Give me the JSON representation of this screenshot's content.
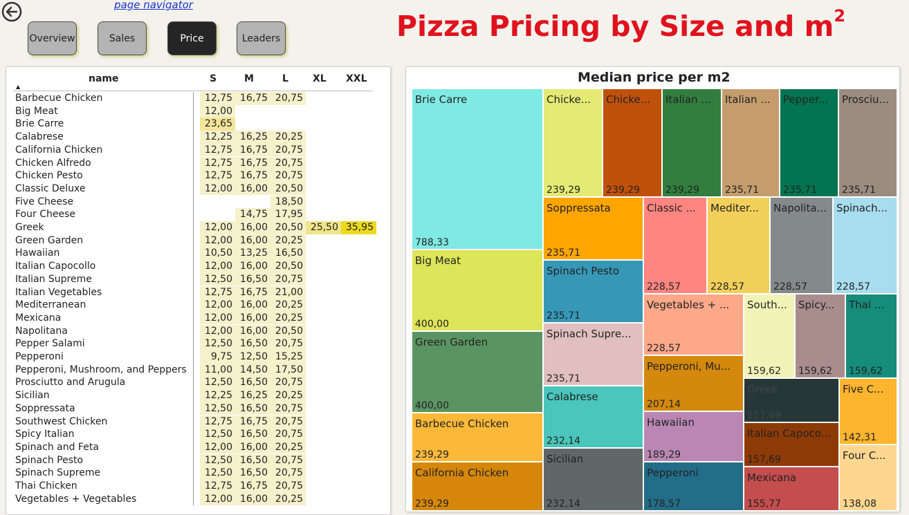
{
  "nav": {
    "link_text": "page navigator",
    "buttons": [
      "Overview",
      "Sales",
      "Price",
      "Leaders"
    ],
    "active": "Price"
  },
  "title": "Pizza Pricing by Size and m",
  "title_sup": "2",
  "table": {
    "columns": [
      "name",
      "S",
      "M",
      "L",
      "XL",
      "XXL"
    ],
    "rows": [
      {
        "name": "Barbecue Chicken",
        "S": "12,75",
        "M": "16,75",
        "L": "20,75"
      },
      {
        "name": "Big Meat",
        "S": "12,00"
      },
      {
        "name": "Brie Carre",
        "S": "23,65"
      },
      {
        "name": "Calabrese",
        "S": "12,25",
        "M": "16,25",
        "L": "20,25"
      },
      {
        "name": "California Chicken",
        "S": "12,75",
        "M": "16,75",
        "L": "20,75"
      },
      {
        "name": "Chicken Alfredo",
        "S": "12,75",
        "M": "16,75",
        "L": "20,75"
      },
      {
        "name": "Chicken Pesto",
        "S": "12,75",
        "M": "16,75",
        "L": "20,75"
      },
      {
        "name": "Classic Deluxe",
        "S": "12,00",
        "M": "16,00",
        "L": "20,50"
      },
      {
        "name": "Five Cheese",
        "L": "18,50"
      },
      {
        "name": "Four Cheese",
        "M": "14,75",
        "L": "17,95"
      },
      {
        "name": "Greek",
        "S": "12,00",
        "M": "16,00",
        "L": "20,50",
        "XL": "25,50",
        "XXL": "35,95"
      },
      {
        "name": "Green Garden",
        "S": "12,00",
        "M": "16,00",
        "L": "20,25"
      },
      {
        "name": "Hawaiian",
        "S": "10,50",
        "M": "13,25",
        "L": "16,50"
      },
      {
        "name": "Italian Capocollo",
        "S": "12,00",
        "M": "16,00",
        "L": "20,50"
      },
      {
        "name": "Italian Supreme",
        "S": "12,50",
        "M": "16,50",
        "L": "20,75"
      },
      {
        "name": "Italian Vegetables",
        "S": "12,75",
        "M": "16,75",
        "L": "21,00"
      },
      {
        "name": "Mediterranean",
        "S": "12,00",
        "M": "16,00",
        "L": "20,25"
      },
      {
        "name": "Mexicana",
        "S": "12,00",
        "M": "16,00",
        "L": "20,25"
      },
      {
        "name": "Napolitana",
        "S": "12,00",
        "M": "16,00",
        "L": "20,50"
      },
      {
        "name": "Pepper Salami",
        "S": "12,50",
        "M": "16,50",
        "L": "20,75"
      },
      {
        "name": "Pepperoni",
        "S": "9,75",
        "M": "12,50",
        "L": "15,25"
      },
      {
        "name": "Pepperoni, Mushroom, and Peppers",
        "S": "11,00",
        "M": "14,50",
        "L": "17,50"
      },
      {
        "name": "Prosciutto and Arugula",
        "S": "12,50",
        "M": "16,50",
        "L": "20,75"
      },
      {
        "name": "Sicilian",
        "S": "12,25",
        "M": "16,25",
        "L": "20,25"
      },
      {
        "name": "Soppressata",
        "S": "12,50",
        "M": "16,50",
        "L": "20,75"
      },
      {
        "name": "Southwest Chicken",
        "S": "12,75",
        "M": "16,75",
        "L": "20,75"
      },
      {
        "name": "Spicy Italian",
        "S": "12,50",
        "M": "16,50",
        "L": "20,75"
      },
      {
        "name": "Spinach and Feta",
        "S": "12,00",
        "M": "16,00",
        "L": "20,25"
      },
      {
        "name": "Spinach Pesto",
        "S": "12,50",
        "M": "16,50",
        "L": "20,75"
      },
      {
        "name": "Spinach Supreme",
        "S": "12,50",
        "M": "16,50",
        "L": "20,75"
      },
      {
        "name": "Thai Chicken",
        "S": "12,75",
        "M": "16,75",
        "L": "20,75"
      },
      {
        "name": "Vegetables + Vegetables",
        "S": "12,00",
        "M": "16,00",
        "L": "20,25"
      }
    ]
  },
  "chart_data": {
    "type": "treemap",
    "title": "Median price per m2",
    "items": [
      {
        "name": "Brie Carre",
        "label": "Brie Carre",
        "value": "788,33",
        "color": "#7feae3"
      },
      {
        "name": "Big Meat",
        "label": "Big Meat",
        "value": "400,00",
        "color": "#dde558"
      },
      {
        "name": "Green Garden",
        "label": "Green Garden",
        "value": "400,00",
        "color": "#5b9463"
      },
      {
        "name": "Barbecue Chicken",
        "label": "Barbecue Chicken",
        "value": "239,29",
        "color": "#fcb838"
      },
      {
        "name": "California Chicken",
        "label": "California Chicken",
        "value": "239,29",
        "color": "#d6870a"
      },
      {
        "name": "Chicken Alfredo",
        "label": "Chicke...",
        "value": "239,29",
        "color": "#e5ea74"
      },
      {
        "name": "Chicken Pesto",
        "label": "Chicke...",
        "value": "239,29",
        "color": "#c0510a"
      },
      {
        "name": "Italian Supreme",
        "label": "Italian ...",
        "value": "239,29",
        "color": "#317e3e"
      },
      {
        "name": "Italian Vegetables",
        "label": "Italian ...",
        "value": "235,71",
        "color": "#c59d6d"
      },
      {
        "name": "Pepper Salami",
        "label": "Pepper...",
        "value": "235,71",
        "color": "#02744f"
      },
      {
        "name": "Prosciutto and Arugula",
        "label": "Prosciu...",
        "value": "235,71",
        "color": "#9b8c80"
      },
      {
        "name": "Soppressata",
        "label": "Soppressata",
        "value": "235,71",
        "color": "#fea500"
      },
      {
        "name": "Spinach Pesto",
        "label": "Spinach Pesto",
        "value": "235,71",
        "color": "#3698b6"
      },
      {
        "name": "Spinach Supreme",
        "label": "Spinach Supre...",
        "value": "235,71",
        "color": "#e1bfbf"
      },
      {
        "name": "Calabrese",
        "label": "Calabrese",
        "value": "232,14",
        "color": "#4ac6bc"
      },
      {
        "name": "Sicilian",
        "label": "Sicilian",
        "value": "232,14",
        "color": "#5f6769"
      },
      {
        "name": "Classic Deluxe",
        "label": "Classic ...",
        "value": "228,57",
        "color": "#ff8580"
      },
      {
        "name": "Mediterranean",
        "label": "Mediter...",
        "value": "228,57",
        "color": "#f3d05b"
      },
      {
        "name": "Napolitana",
        "label": "Napolita...",
        "value": "228,57",
        "color": "#848a8a"
      },
      {
        "name": "Spinach and Feta",
        "label": "Spinach...",
        "value": "228,57",
        "color": "#a7ddee"
      },
      {
        "name": "Vegetables + Vegetables",
        "label": "Vegetables + ...",
        "value": "228,57",
        "color": "#fea88a"
      },
      {
        "name": "Pepperoni, Mushroom, and Peppers",
        "label": "Pepperoni, Mu...",
        "value": "207,14",
        "color": "#d4880c"
      },
      {
        "name": "Hawaiian",
        "label": "Hawaiian",
        "value": "189,29",
        "color": "#ba87b4"
      },
      {
        "name": "Pepperoni",
        "label": "Pepperoni",
        "value": "178,57",
        "color": "#226d88"
      },
      {
        "name": "Southwest Chicken",
        "label": "South...",
        "value": "159,62",
        "color": "#f0f4b7"
      },
      {
        "name": "Spicy Italian",
        "label": "Spicy...",
        "value": "159,62",
        "color": "#a98d8d"
      },
      {
        "name": "Thai Chicken",
        "label": "Thai ...",
        "value": "159,62",
        "color": "#168c7b"
      },
      {
        "name": "Greek",
        "label": "Greek",
        "value": "157,69",
        "color": "#273636"
      },
      {
        "name": "Italian Capocollo",
        "label": "Italian Capoco...",
        "value": "157,69",
        "color": "#8e3a06"
      },
      {
        "name": "Mexicana",
        "label": "Mexicana",
        "value": "155,77",
        "color": "#c44d4d"
      },
      {
        "name": "Five Cheese",
        "label": "Five C...",
        "value": "142,31",
        "color": "#fdb42f"
      },
      {
        "name": "Four Cheese",
        "label": "Four C...",
        "value": "138,08",
        "color": "#fed690"
      }
    ]
  }
}
